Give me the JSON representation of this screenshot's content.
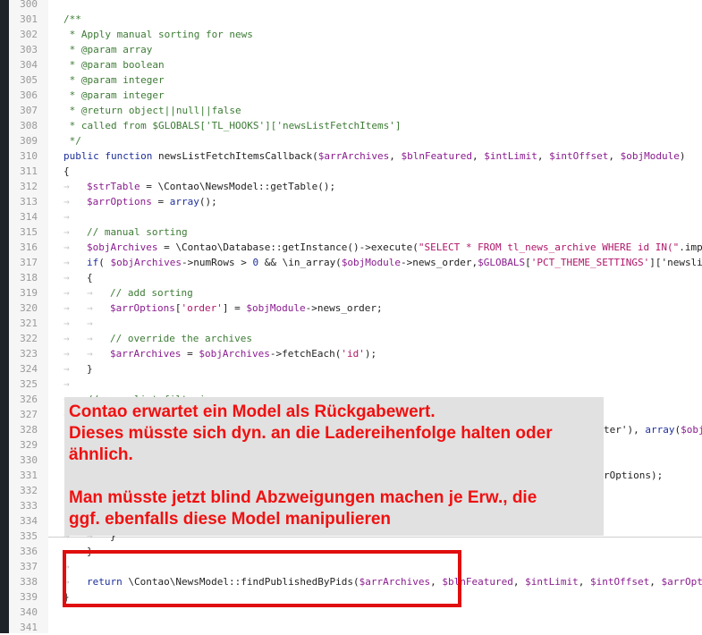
{
  "editor": {
    "lines": [
      {
        "n": "300",
        "t": ""
      },
      {
        "n": "301",
        "t": "/**"
      },
      {
        "n": "302",
        "t": " * Apply manual sorting for news"
      },
      {
        "n": "303",
        "t": " * @param array"
      },
      {
        "n": "304",
        "t": " * @param boolean"
      },
      {
        "n": "305",
        "t": " * @param integer"
      },
      {
        "n": "306",
        "t": " * @param integer"
      },
      {
        "n": "307",
        "t": " * @return object||null||false"
      },
      {
        "n": "308",
        "t": " * called from $GLOBALS['TL_HOOKS']['newsListFetchItems']"
      },
      {
        "n": "309",
        "t": " */"
      },
      {
        "n": "310",
        "t": "public function newsListFetchItemsCallback($arrArchives, $blnFeatured, $intLimit, $intOffset, $objModule)"
      },
      {
        "n": "311",
        "t": "{"
      },
      {
        "n": "312",
        "t": "$strTable = \\Contao\\NewsModel::getTable();"
      },
      {
        "n": "313",
        "t": "$arrOptions = array();"
      },
      {
        "n": "314",
        "t": ""
      },
      {
        "n": "315",
        "t": "// manual sorting"
      },
      {
        "n": "316",
        "t": "$objArchives = \\Contao\\Database::getInstance()->execute(\"SELECT * FROM tl_news_archive WHERE id IN(\".imp"
      },
      {
        "n": "317",
        "t": "if( $objArchives->numRows > 0 && \\in_array($objModule->news_order,$GLOBALS['PCT_THEME_SETTINGS']['newsli"
      },
      {
        "n": "318",
        "t": "{"
      },
      {
        "n": "319",
        "t": "// add sorting"
      },
      {
        "n": "320",
        "t": "$arrOptions['order'] = $objModule->news_order;"
      },
      {
        "n": "321",
        "t": ""
      },
      {
        "n": "322",
        "t": "// override the archives"
      },
      {
        "n": "323",
        "t": "$arrArchives = $objArchives->fetchEach('id');"
      },
      {
        "n": "324",
        "t": "}"
      },
      {
        "n": "325",
        "t": ""
      },
      {
        "n": "326",
        "t": "// news list filtering"
      },
      {
        "n": "327",
        "t": ""
      },
      {
        "n": "328",
        "t": "ter'), array($obj"
      },
      {
        "n": "329",
        "t": ""
      },
      {
        "n": "330",
        "t": ""
      },
      {
        "n": "331",
        "t": "rOptions);"
      },
      {
        "n": "332",
        "t": ""
      },
      {
        "n": "333",
        "t": ""
      },
      {
        "n": "334",
        "t": ""
      },
      {
        "n": "335",
        "t": "}"
      },
      {
        "n": "336",
        "t": "}"
      },
      {
        "n": "337",
        "t": ""
      },
      {
        "n": "338",
        "t": "return \\Contao\\NewsModel::findPublishedByPids($arrArchives, $blnFeatured, $intLimit, $intOffset, $arrOpt"
      },
      {
        "n": "339",
        "t": "}"
      },
      {
        "n": "340",
        "t": ""
      },
      {
        "n": "341",
        "t": ""
      }
    ]
  },
  "annotation": {
    "lines": [
      "Contao erwartet ein Model als Rückgabewert.",
      "Dieses müsste sich dyn. an die Ladereihenfolge halten oder",
      "ähnlich.",
      "",
      "Man müsste jetzt blind Abzweigungen machen je Erw., die",
      "ggf. ebenfalls diese Model manipulieren"
    ],
    "text_color": "#ef1111",
    "box_color": "#e00e0e"
  }
}
